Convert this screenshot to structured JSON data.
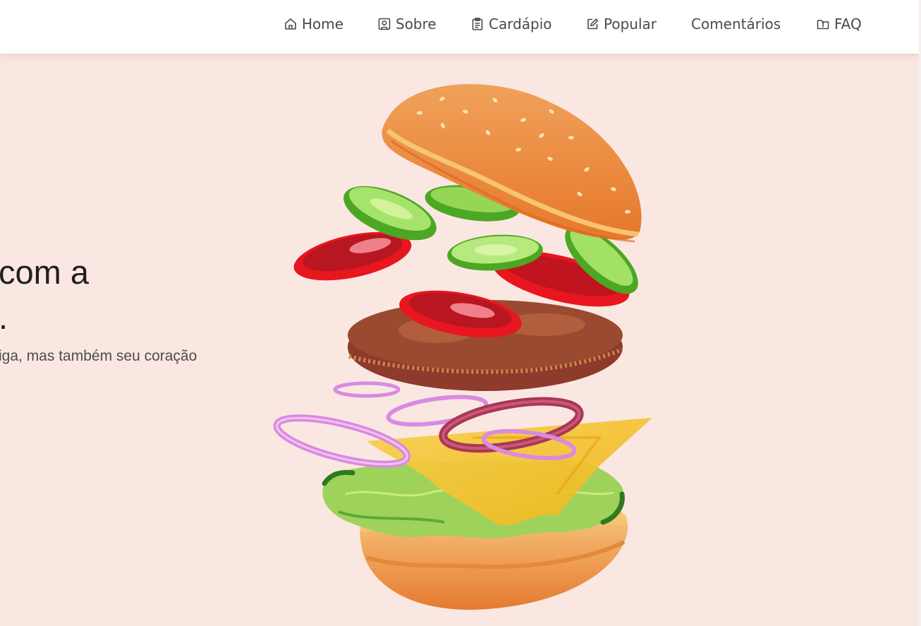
{
  "nav": {
    "home": "Home",
    "sobre": "Sobre",
    "cardapio": "Cardápio",
    "popular": "Popular",
    "comentarios": "Comentários",
    "faq": "FAQ"
  },
  "icons": {
    "home": "home-icon",
    "sobre": "user-square-icon",
    "cardapio": "clipboard-list-icon",
    "popular": "edit-icon",
    "faq": "info-folder-icon"
  },
  "hero": {
    "title_line1": "com a",
    "title_line2": ".",
    "text": "iga, mas também seu coração"
  },
  "colors": {
    "background": "#fbe7e1",
    "navbar": "#ffffff",
    "nav_text": "#4a4a4a"
  }
}
